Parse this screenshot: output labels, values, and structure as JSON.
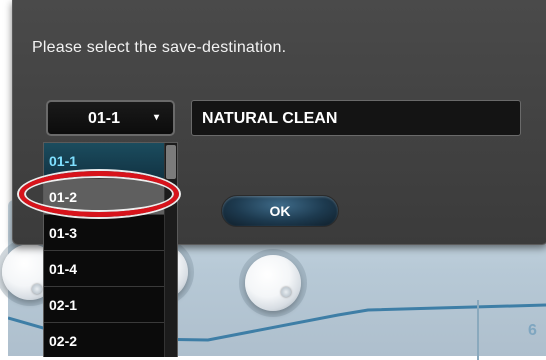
{
  "dialog": {
    "message": "Please select the save-destination.",
    "slot_select": {
      "value": "01-1",
      "chevron": "▾"
    },
    "name_field": {
      "value": "NATURAL CLEAN"
    },
    "ok_label": "OK"
  },
  "dropdown": {
    "items": [
      {
        "label": "01-1",
        "state": "selected"
      },
      {
        "label": "01-2",
        "state": "highlighted"
      },
      {
        "label": "01-3",
        "state": "normal"
      },
      {
        "label": "01-4",
        "state": "normal"
      },
      {
        "label": "02-1",
        "state": "normal"
      },
      {
        "label": "02-2",
        "state": "normal"
      }
    ]
  },
  "background": {
    "partial_number": "6"
  },
  "colors": {
    "dialog_bg": "#424242",
    "selected_text": "#7fe0ff",
    "highlight_bg": "#5f5f5f",
    "callout_red": "#d7131b",
    "ok_button": "#1d3a4f"
  },
  "icons": {
    "chevron": "chevron-down-icon",
    "knob": "knob-icon"
  }
}
